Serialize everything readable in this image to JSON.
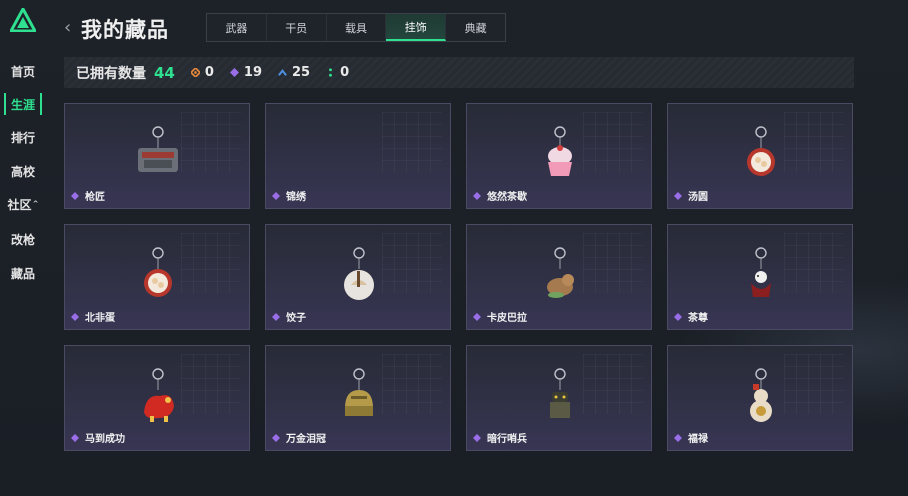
{
  "sidebar": {
    "items": [
      {
        "label": "首页",
        "active": false
      },
      {
        "label": "生涯",
        "active": true
      },
      {
        "label": "排行",
        "active": false
      },
      {
        "label": "高校",
        "active": false
      },
      {
        "label": "社区",
        "active": false,
        "chevron": "^"
      },
      {
        "label": "改枪",
        "active": false
      },
      {
        "label": "藏品",
        "active": false
      }
    ]
  },
  "header": {
    "back_icon": "chevron-left-icon",
    "title": "我的藏品",
    "tabs": [
      {
        "label": "武器",
        "active": false
      },
      {
        "label": "干员",
        "active": false
      },
      {
        "label": "载具",
        "active": false
      },
      {
        "label": "挂饰",
        "active": true
      },
      {
        "label": "典藏",
        "active": false
      }
    ]
  },
  "stats": {
    "owned_label": "已拥有数量",
    "owned_count": "44",
    "items": [
      {
        "icon": "orange-diamond-icon",
        "color": "#e2853a",
        "value": "0"
      },
      {
        "icon": "purple-diamond-icon",
        "color": "#9a6ee8",
        "value": "19"
      },
      {
        "icon": "blue-chevron-icon",
        "color": "#4d8fe0",
        "value": "25"
      },
      {
        "icon": "green-dots-icon",
        "color": "#2ee08f",
        "value": "0"
      }
    ]
  },
  "charms": [
    {
      "name": "枪匠",
      "art": "gun-charm"
    },
    {
      "name": "锦绣",
      "art": "empty"
    },
    {
      "name": "悠然茶歇",
      "art": "cupcake-charm"
    },
    {
      "name": "汤圆",
      "art": "bowl-charm"
    },
    {
      "name": "北非蛋",
      "art": "bowl-charm"
    },
    {
      "name": "饺子",
      "art": "plate-charm"
    },
    {
      "name": "卡皮巴拉",
      "art": "capybara-charm"
    },
    {
      "name": "茶尊",
      "art": "figure-charm"
    },
    {
      "name": "马到成功",
      "art": "horse-charm"
    },
    {
      "name": "万金泪冠",
      "art": "helmet-charm"
    },
    {
      "name": "暗行哨兵",
      "art": "soldier-charm"
    },
    {
      "name": "福禄",
      "art": "gourd-charm"
    }
  ],
  "colors": {
    "accent": "#2ee08f",
    "rarity_purple": "#9a6ee8"
  }
}
